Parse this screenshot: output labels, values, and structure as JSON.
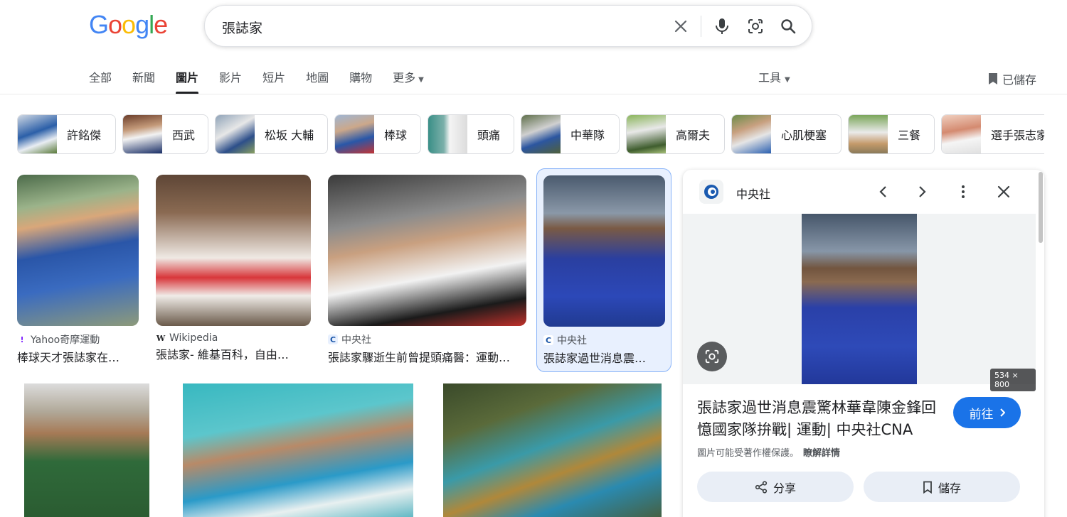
{
  "google_logo": {
    "g1": "G",
    "o1": "o",
    "o2": "o",
    "g2": "g",
    "l": "l",
    "e": "e",
    "colors": {
      "blue": "#4285F4",
      "red": "#EA4335",
      "yellow": "#FBBC05",
      "green": "#34A853"
    }
  },
  "search": {
    "query": "張誌家"
  },
  "tabs": [
    {
      "label": "全部"
    },
    {
      "label": "新聞"
    },
    {
      "label": "圖片",
      "active": true
    },
    {
      "label": "影片"
    },
    {
      "label": "短片"
    },
    {
      "label": "地圖"
    },
    {
      "label": "購物"
    },
    {
      "label": "更多"
    }
  ],
  "tools_label": "工具",
  "saved_label": "已儲存",
  "chips": [
    {
      "label": "許銘傑"
    },
    {
      "label": "西武"
    },
    {
      "label": "松坂 大輔"
    },
    {
      "label": "棒球"
    },
    {
      "label": "頭痛"
    },
    {
      "label": "中華隊"
    },
    {
      "label": "高爾夫"
    },
    {
      "label": "心肌梗塞"
    },
    {
      "label": "三餐"
    },
    {
      "label": "選手張志家"
    }
  ],
  "results": [
    {
      "source": "Yahoo奇摩運動",
      "title": "棒球天才張誌家在…"
    },
    {
      "source": "Wikipedia",
      "title": "張誌家- 維基百科，自由…"
    },
    {
      "source": "中央社",
      "title": "張誌家驟逝生前曾提頭痛醫：運動…"
    },
    {
      "source": "中央社",
      "title": "張誌家過世消息震…",
      "selected": true
    }
  ],
  "panel": {
    "site": "中央社",
    "dimensions": "534 × 800",
    "title": "張誌家過世消息震驚林華韋陳金鋒回憶國家隊拚戰| 運動| 中央社CNA",
    "visit_label": "前往",
    "copyright_note": "圖片可能受著作權保護。",
    "learn_more": "瞭解詳情",
    "share_label": "分享",
    "save_label": "儲存"
  },
  "accent_color": "#1a73e8"
}
